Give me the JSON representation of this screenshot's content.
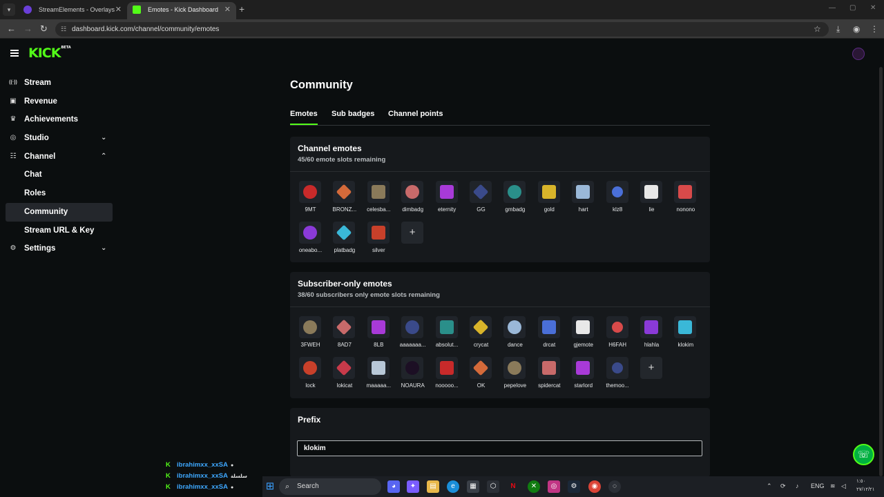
{
  "browser": {
    "tabs": [
      {
        "title": "StreamElements - Overlays",
        "active": false
      },
      {
        "title": "Emotes - Kick Dashboard",
        "active": true
      }
    ],
    "url": "dashboard.kick.com/channel/community/emotes"
  },
  "brand": {
    "logo": "KICK",
    "badge": "BETA",
    "accent": "#53fc18"
  },
  "sidebar": {
    "items": [
      {
        "label": "Stream",
        "icon": "broadcast-icon"
      },
      {
        "label": "Revenue",
        "icon": "wallet-icon"
      },
      {
        "label": "Achievements",
        "icon": "trophy-icon"
      },
      {
        "label": "Studio",
        "icon": "studio-icon",
        "expandable": "collapsed"
      },
      {
        "label": "Channel",
        "icon": "channel-icon",
        "expandable": "expanded"
      },
      {
        "label": "Chat",
        "sub": true
      },
      {
        "label": "Roles",
        "sub": true
      },
      {
        "label": "Community",
        "sub": true,
        "active": true
      },
      {
        "label": "Stream URL & Key",
        "sub": true
      },
      {
        "label": "Settings",
        "icon": "gear-icon",
        "expandable": "collapsed"
      }
    ]
  },
  "main": {
    "title": "Community",
    "tabs": [
      {
        "label": "Emotes",
        "selected": true
      },
      {
        "label": "Sub badges"
      },
      {
        "label": "Channel points"
      }
    ],
    "channel_emotes": {
      "heading": "Channel emotes",
      "slots": "45/60 emote slots remaining",
      "emotes": [
        "9MT",
        "BRONZ...",
        "celesba...",
        "dimbadg",
        "eternity",
        "GG",
        "gmbadg",
        "gold",
        "hart",
        "klz8",
        "lie",
        "nonono",
        "oneabo...",
        "platbadg",
        "silver"
      ]
    },
    "subscriber_emotes": {
      "heading": "Subscriber-only emotes",
      "slots": "38/60 subscribers only emote slots remaining",
      "emotes": [
        "3FWEH",
        "8AD7",
        "8LB",
        "aaaaaaa...",
        "absolut...",
        "crycat",
        "dance",
        "drcat",
        "gjemote",
        "H6FAH",
        "hlahla",
        "klokim",
        "lock",
        "lokicat",
        "maaaaa...",
        "NOAURA",
        "nooooo...",
        "OK",
        "pepelove",
        "spidercat",
        "starlord",
        "themoo..."
      ]
    },
    "prefix": {
      "heading": "Prefix",
      "value": "klokim"
    }
  },
  "chat_overlay": {
    "lines": [
      {
        "user": "ibrahimxx_xxSA"
      },
      {
        "user": "ibrahimxx_xxSA",
        "message": "سلسلة"
      },
      {
        "user": "ibrahimxx_xxSA"
      }
    ]
  },
  "taskbar": {
    "search_label": "Search",
    "lang": "ENG",
    "date": "٢٧/١٢/٢١",
    "time": "١:٥٠"
  }
}
